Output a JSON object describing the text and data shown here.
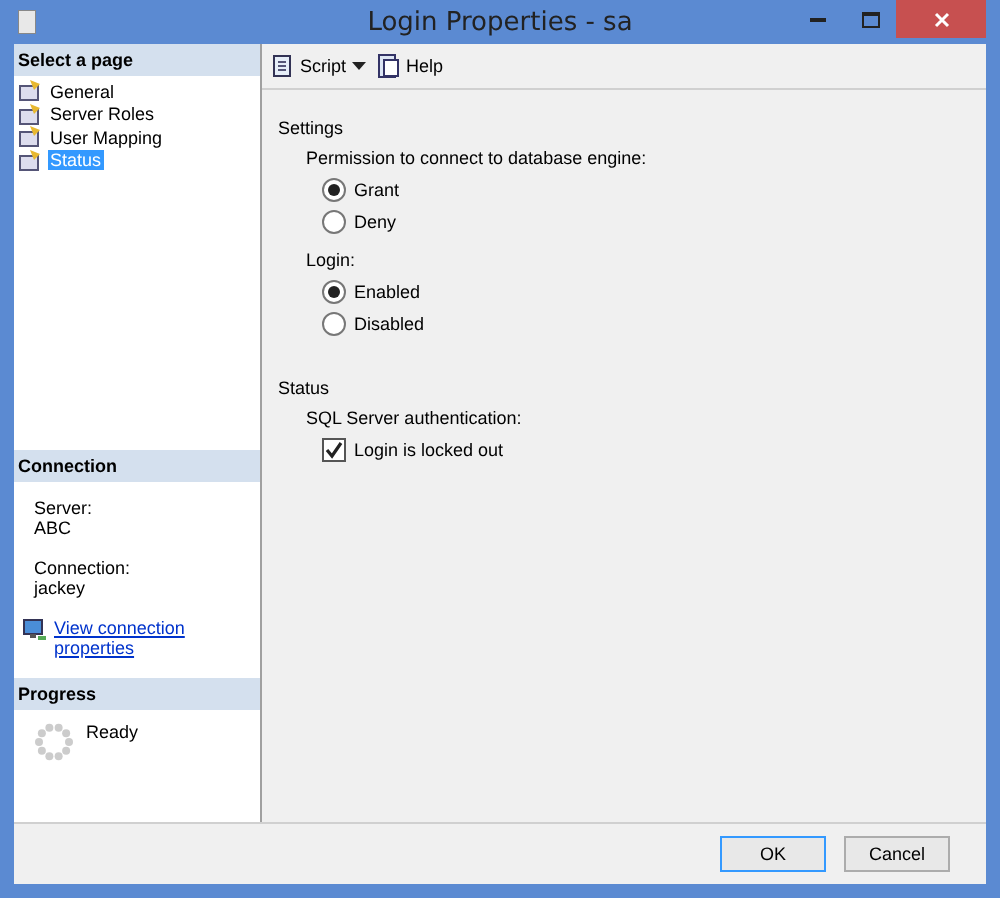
{
  "window": {
    "title": "Login Properties - sa"
  },
  "sidebar": {
    "header": "Select a page",
    "items": [
      {
        "label": "General",
        "selected": false
      },
      {
        "label": "Server Roles",
        "selected": false
      },
      {
        "label": "User Mapping",
        "selected": false
      },
      {
        "label": "Status",
        "selected": true
      }
    ]
  },
  "connection": {
    "header": "Connection",
    "fields": [
      {
        "label": "Server:",
        "value": "ABC"
      },
      {
        "label": "Connection:",
        "value": "jackey"
      }
    ],
    "link": "View connection properties"
  },
  "progress": {
    "header": "Progress",
    "status": "Ready"
  },
  "toolbar": [
    {
      "label": "Script",
      "kind": "script",
      "dropdown": true
    },
    {
      "label": "Help",
      "kind": "help",
      "dropdown": false
    }
  ],
  "sections": [
    {
      "title": "Settings",
      "groups": [
        {
          "label": "Permission to connect to database engine:",
          "kind": "radio",
          "options": [
            {
              "label": "Grant",
              "selected": true
            },
            {
              "label": "Deny",
              "selected": false
            }
          ]
        },
        {
          "label": "Login:",
          "kind": "radio",
          "options": [
            {
              "label": "Enabled",
              "selected": true
            },
            {
              "label": "Disabled",
              "selected": false
            }
          ]
        }
      ]
    },
    {
      "title": "Status",
      "groups": [
        {
          "label": "SQL Server authentication:",
          "kind": "checkbox",
          "options": [
            {
              "label": "Login is locked out",
              "checked": true
            }
          ]
        }
      ]
    }
  ],
  "buttons": [
    {
      "label": "OK",
      "default": true
    },
    {
      "label": "Cancel",
      "default": false
    }
  ]
}
